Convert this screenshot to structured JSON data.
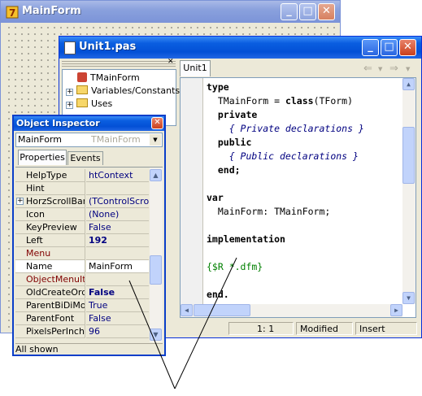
{
  "main_form": {
    "title": "MainForm",
    "title_icon": "delphi-form-icon"
  },
  "unit_window": {
    "title": "Unit1.pas",
    "title_icon": "document-icon",
    "tree": {
      "root": "TMainForm",
      "items": [
        "Variables/Constants",
        "Uses"
      ]
    },
    "tab": "Unit1",
    "nav": {
      "back": "⇐",
      "forward": "⇒"
    },
    "code_lines": [
      {
        "kind": "kw",
        "text": "type"
      },
      {
        "kind": "mix",
        "parts": [
          {
            "t": "  TMainForm = ",
            "k": ""
          },
          {
            "t": "class",
            "k": "kw"
          },
          {
            "t": "(TForm)",
            "k": ""
          }
        ]
      },
      {
        "kind": "kw",
        "text": "  private"
      },
      {
        "kind": "cm",
        "text": "    { Private declarations }"
      },
      {
        "kind": "kw",
        "text": "  public"
      },
      {
        "kind": "cm",
        "text": "    { Public declarations }"
      },
      {
        "kind": "kw",
        "text": "  end;"
      },
      {
        "kind": "",
        "text": ""
      },
      {
        "kind": "kw",
        "text": "var"
      },
      {
        "kind": "",
        "text": "  MainForm: TMainForm;"
      },
      {
        "kind": "",
        "text": ""
      },
      {
        "kind": "kw",
        "text": "implementation"
      },
      {
        "kind": "",
        "text": ""
      },
      {
        "kind": "dir",
        "text": "{$R *.dfm}"
      },
      {
        "kind": "",
        "text": ""
      },
      {
        "kind": "kw",
        "text": "end."
      }
    ],
    "status": {
      "position": "1:  1",
      "modified": "Modified",
      "mode": "Insert"
    }
  },
  "object_inspector": {
    "title": "Object Inspector",
    "selected_object": "MainForm",
    "selected_type": "TMainForm",
    "tabs": [
      "Properties",
      "Events"
    ],
    "properties": [
      {
        "name": "HelpType",
        "value": "htContext",
        "style": ""
      },
      {
        "name": "Hint",
        "value": "",
        "style": ""
      },
      {
        "name": "HorzScrollBar",
        "value": "(TControlScrollB",
        "style": "",
        "expandable": true
      },
      {
        "name": "Icon",
        "value": "(None)",
        "style": ""
      },
      {
        "name": "KeyPreview",
        "value": "False",
        "style": ""
      },
      {
        "name": "Left",
        "value": "192",
        "style": "bold"
      },
      {
        "name": "Menu",
        "value": "",
        "style": "red"
      },
      {
        "name": "Name",
        "value": "MainForm",
        "style": "sel"
      },
      {
        "name": "ObjectMenuItem",
        "value": "",
        "style": "red"
      },
      {
        "name": "OldCreateOrder",
        "value": "False",
        "style": "bold"
      },
      {
        "name": "ParentBiDiMode",
        "value": "True",
        "style": ""
      },
      {
        "name": "ParentFont",
        "value": "False",
        "style": ""
      },
      {
        "name": "PixelsPerInch",
        "value": "96",
        "style": ""
      }
    ],
    "status": "All shown"
  },
  "colors": {
    "title_active": "#0a5ee0",
    "code_comment": "#000080",
    "code_directive": "#008000",
    "prop_value": "#000080",
    "prop_ref": "#800000"
  }
}
